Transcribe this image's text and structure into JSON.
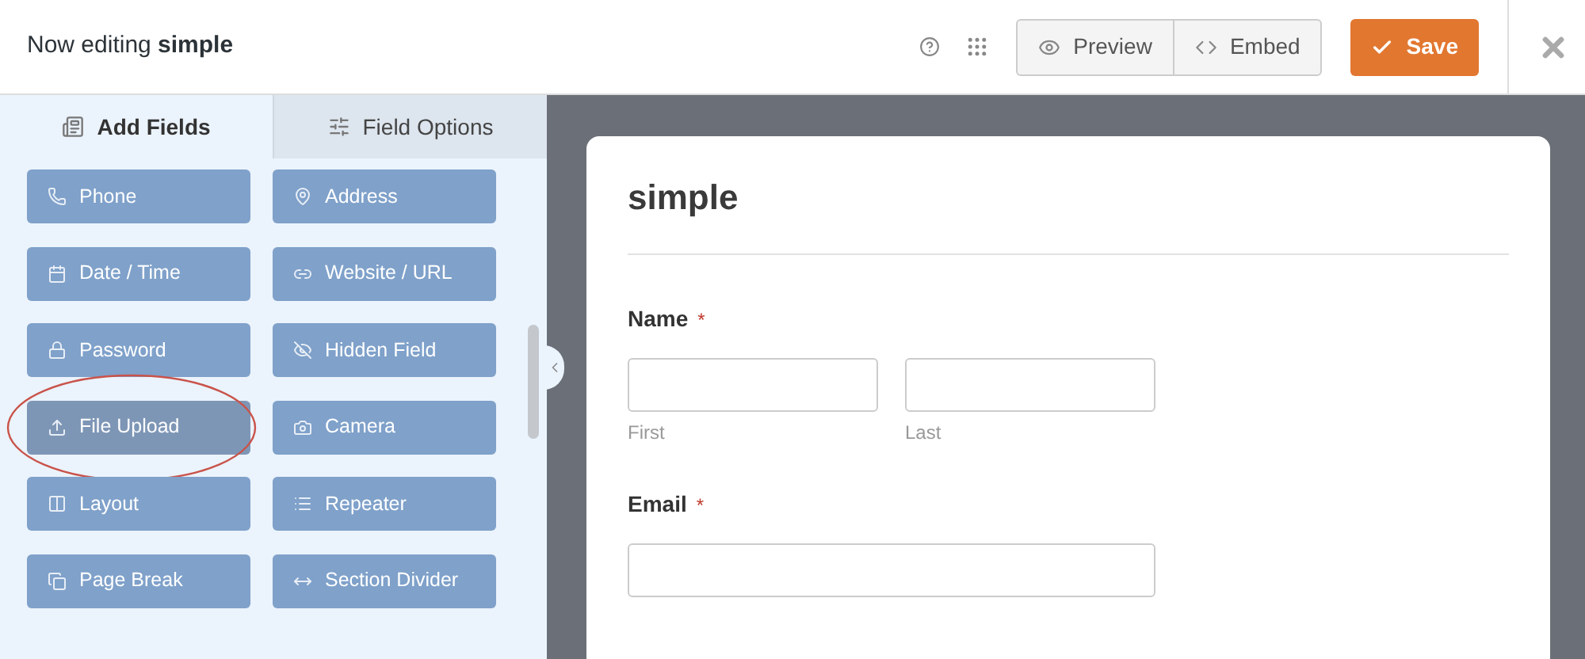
{
  "header": {
    "title": "Now editing **simple**",
    "buttons": [
      {
        "kind": "preview",
        "label": "Preview"
      },
      {
        "kind": "embed",
        "label": "Embed"
      }
    ],
    "save": "Save"
  },
  "sidebar": {
    "tabs": [
      {
        "label": "Add Fields",
        "selected": true
      },
      {
        "label": "Field Options",
        "selected": false
      }
    ],
    "fields": [
      {
        "label": "Phone",
        "highlighted": false,
        "circled": false
      },
      {
        "label": "Address",
        "highlighted": false,
        "circled": false
      },
      {
        "label": "Date / Time",
        "highlighted": false,
        "circled": false
      },
      {
        "label": "Website / URL",
        "highlighted": false,
        "circled": false
      },
      {
        "label": "Password",
        "highlighted": false,
        "circled": false
      },
      {
        "label": "Hidden Field",
        "highlighted": false,
        "circled": false
      },
      {
        "label": "File Upload",
        "highlighted": true,
        "circled": true
      },
      {
        "label": "Camera",
        "highlighted": false,
        "circled": false
      },
      {
        "label": "Layout",
        "highlighted": false,
        "circled": false
      },
      {
        "label": "Repeater",
        "highlighted": false,
        "circled": false
      },
      {
        "label": "Page Break",
        "highlighted": false,
        "circled": false
      },
      {
        "label": "Section Divider",
        "highlighted": false,
        "circled": false
      }
    ]
  },
  "form": {
    "title": "simple",
    "fields": [
      {
        "kind": "name",
        "label": "Name",
        "required_mark": "*",
        "sublabels": [
          "First",
          "Last"
        ]
      },
      {
        "kind": "email",
        "label": "Email",
        "required_mark": "*"
      }
    ]
  }
}
